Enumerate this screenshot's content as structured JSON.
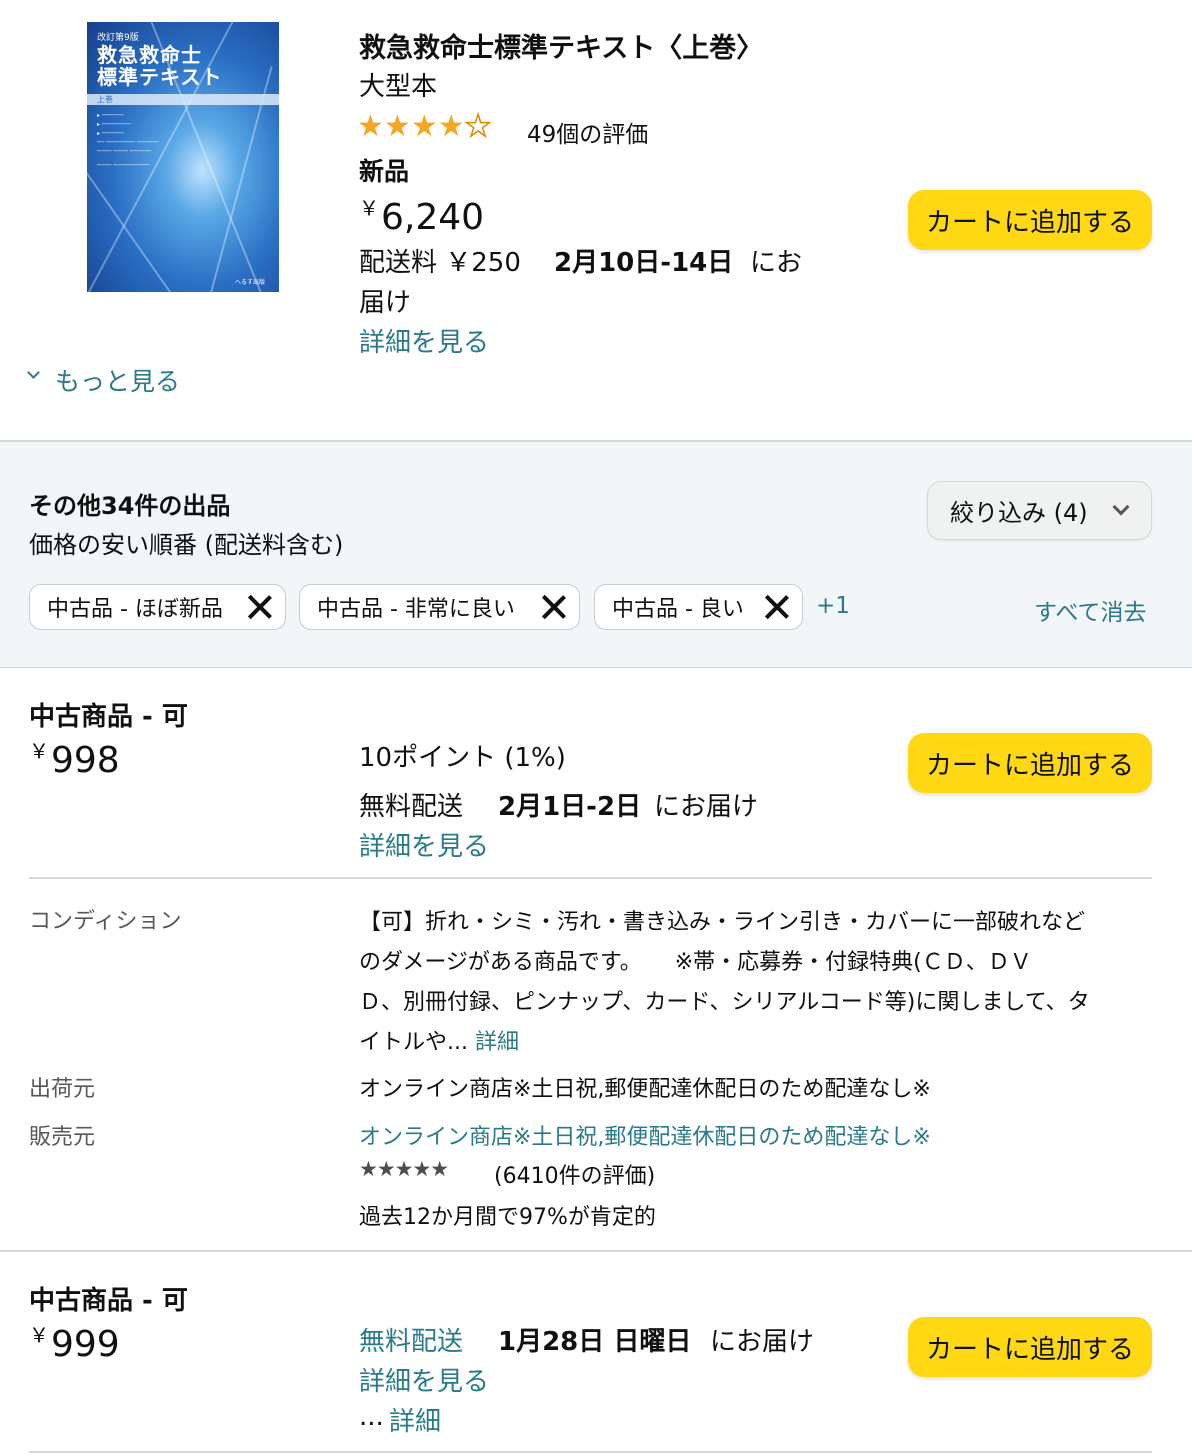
{
  "product": {
    "title": "救急救命士標準テキスト〈上巻〉",
    "format": "大型本",
    "rating_value": 4.5,
    "rating_count_label": "49個の評価",
    "condition": "新品",
    "price_currency": "￥",
    "price_value": "6,240",
    "shipping_label": "配送料 ￥250",
    "delivery_dates": "2月10日-14日",
    "delivery_suffix_1": "にお",
    "delivery_suffix_2": "届け",
    "details_link": "詳細を見る",
    "cart_button": "カートに追加する",
    "cover": {
      "edition": "改訂第9版",
      "title_line1": "救急救命士",
      "title_line2": "標準テキスト",
      "volume": "上巻",
      "publisher": "へるす出版"
    }
  },
  "see_more": "もっと見る",
  "offers_panel": {
    "heading": "その他34件の出品",
    "sort_label": "価格の安い順番 (配送料含む)",
    "filter_button": "絞り込み (4)",
    "chips": [
      {
        "label": "中古品 - ほぼ新品"
      },
      {
        "label": "中古品 - 非常に良い"
      },
      {
        "label": "中古品 - 良い"
      }
    ],
    "more_chips": "+1",
    "clear_all": "すべて消去"
  },
  "offers": [
    {
      "condition": "中古商品 - 可",
      "price_currency": "￥",
      "price_value": "998",
      "points": "10ポイント (1%)",
      "shipping": "無料配送",
      "delivery_dates": "2月1日-2日",
      "delivery_suffix": "にお届け",
      "details_link": "詳細を見る",
      "cart_button": "カートに追加する",
      "condition_label": "コンディション",
      "condition_text_1": "【可】折れ・シミ・汚れ・書き込み・ライン引き・カバーに一部破れなど",
      "condition_text_2": "のダメージがある商品です。　　※帯・応募券・付録特典(ＣＤ、ＤＶ",
      "condition_text_3": "Ｄ、別冊付録、ピンナップ、カード、シリアルコード等)に関しまして、タ",
      "condition_text_4": "イトルや...",
      "condition_more": "詳細",
      "ships_from_label": "出荷元",
      "ships_from": "オンライン商店※土日祝,郵便配達休配日のため配達なし※",
      "sold_by_label": "販売元",
      "sold_by": "オンライン商店※土日祝,郵便配達休配日のため配達なし※",
      "seller_stars": "★★★★★",
      "seller_rating_count": "(6410件の評価)",
      "seller_positive": "過去12か月間で97%が肯定的"
    },
    {
      "condition": "中古商品 - 可",
      "price_currency": "￥",
      "price_value": "999",
      "shipping": "無料配送",
      "delivery_dates": "1月28日 日曜日",
      "delivery_suffix": "にお届け",
      "details_link": "詳細を見る",
      "ellipsis": "...",
      "more_link": "詳細",
      "cart_button": "カートに追加する"
    }
  ]
}
